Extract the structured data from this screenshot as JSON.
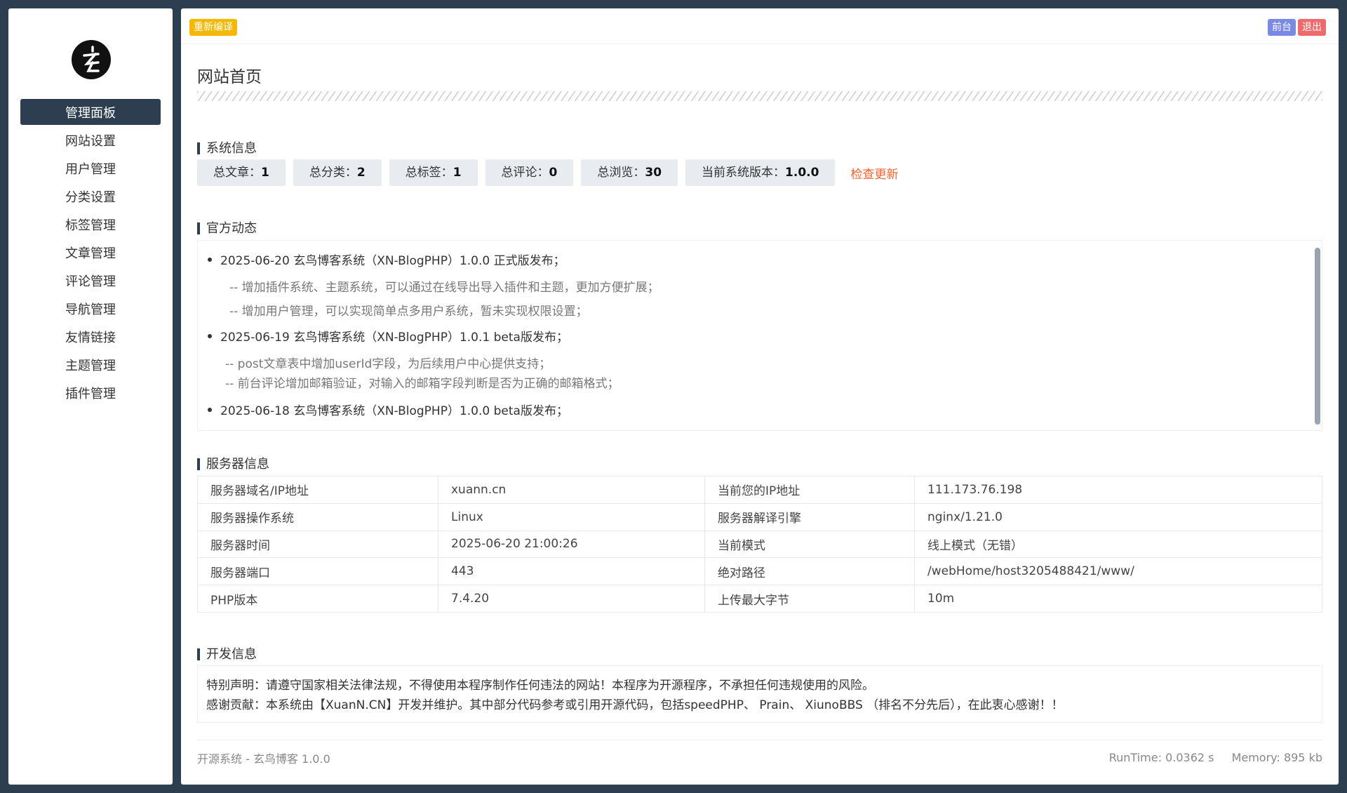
{
  "sidebar": {
    "logo_icon": "brand-logo-icon",
    "items": [
      {
        "label": "管理面板",
        "active": true
      },
      {
        "label": "网站设置"
      },
      {
        "label": "用户管理"
      },
      {
        "label": "分类设置"
      },
      {
        "label": "标签管理"
      },
      {
        "label": "文章管理"
      },
      {
        "label": "评论管理"
      },
      {
        "label": "导航管理"
      },
      {
        "label": "友情链接"
      },
      {
        "label": "主题管理"
      },
      {
        "label": "插件管理"
      }
    ]
  },
  "topbar": {
    "recompile_label": "重新编译",
    "front_label": "前台",
    "logout_label": "退出"
  },
  "page": {
    "title": "网站首页"
  },
  "system_info": {
    "title": "系统信息",
    "stats": [
      {
        "label": "总文章：",
        "value": "1"
      },
      {
        "label": "总分类：",
        "value": "2"
      },
      {
        "label": "总标签：",
        "value": "1"
      },
      {
        "label": "总评论：",
        "value": "0"
      },
      {
        "label": "总浏览：",
        "value": "30"
      },
      {
        "label": "当前系统版本：",
        "value": "1.0.0"
      }
    ],
    "check_update": "检查更新"
  },
  "news": {
    "title": "官方动态",
    "items": [
      {
        "headline": "2025-06-20 玄鸟博客系统（XN-BlogPHP）1.0.0 正式版发布；",
        "details": [
          "-- 增加插件系统、主题系统，可以通过在线导出导入插件和主题，更加方便扩展；",
          "-- 增加用户管理，可以实现简单点多用户系统，暂未实现权限设置；"
        ]
      },
      {
        "headline": "2025-06-19 玄鸟博客系统（XN-BlogPHP）1.0.1 beta版发布；",
        "details": [
          "-- post文章表中增加userId字段，为后续用户中心提供支持；",
          "-- 前台评论增加邮箱验证，对输入的邮箱字段判断是否为正确的邮箱格式；"
        ]
      },
      {
        "headline": "2025-06-18 玄鸟博客系统（XN-BlogPHP）1.0.0 beta版发布；",
        "details": []
      }
    ]
  },
  "server": {
    "title": "服务器信息",
    "rows": [
      [
        "服务器域名/IP地址",
        "xuann.cn",
        "当前您的IP地址",
        "111.173.76.198"
      ],
      [
        "服务器操作系统",
        "Linux",
        "服务器解译引擎",
        "nginx/1.21.0"
      ],
      [
        "服务器时间",
        "2025-06-20 21:00:26",
        "当前模式",
        "线上模式（无错）"
      ],
      [
        "服务器端口",
        "443",
        "绝对路径",
        "/webHome/host3205488421/www/"
      ],
      [
        "PHP版本",
        "7.4.20",
        "上传最大字节",
        "10m"
      ]
    ]
  },
  "dev": {
    "title": "开发信息",
    "line1": "特别声明：请遵守国家相关法律法规，不得使用本程序制作任何违法的网站！本程序为开源程序，不承担任何违规使用的风险。",
    "line2": "感谢贡献：本系统由【XuanN.CN】开发并维护。其中部分代码参考或引用开源代码，包括speedPHP、 Prain、 XiunoBBS （排名不分先后），在此衷心感谢！！"
  },
  "footer": {
    "left": "开源系统 -  玄鸟博客 1.0.0",
    "runtime": "RunTime: 0.0362 s",
    "memory": "Memory: 895 kb"
  },
  "colors": {
    "sidebar_active": "#2c3e50",
    "recompile": "#f5b800",
    "front": "#7a89e6",
    "logout": "#ef6b6b",
    "update_link": "#f5622b"
  }
}
